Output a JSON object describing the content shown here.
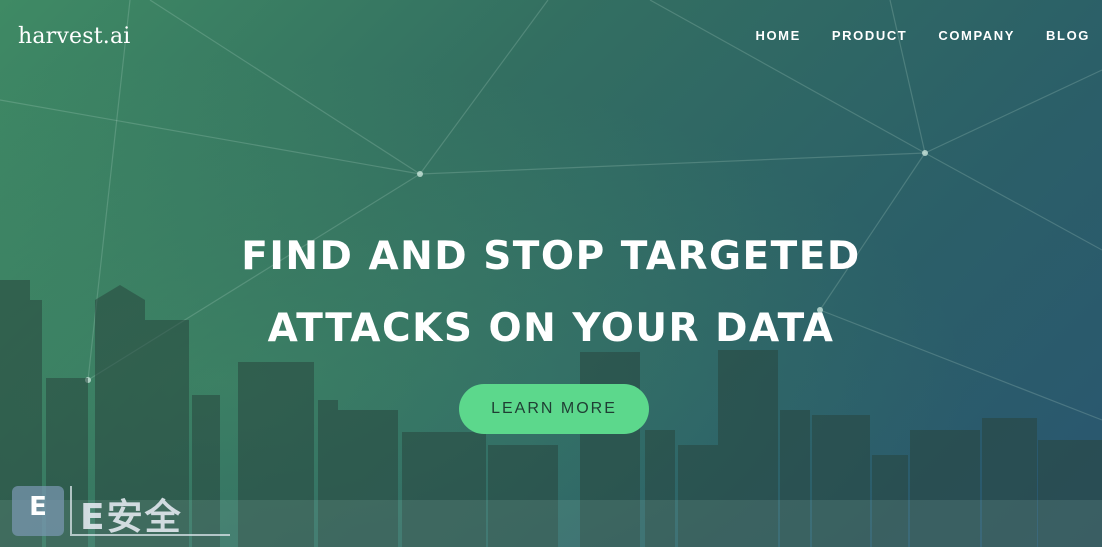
{
  "brand": {
    "logo_text": "harvest.ai"
  },
  "nav": {
    "items": [
      {
        "label": "HOME"
      },
      {
        "label": "PRODUCT"
      },
      {
        "label": "COMPANY"
      },
      {
        "label": "BLOG"
      }
    ]
  },
  "hero": {
    "headline_line1": "FIND AND STOP TARGETED",
    "headline_line2": "ATTACKS ON YOUR DATA",
    "cta_label": "LEARN MORE"
  },
  "watermark": {
    "badge_letter": "E",
    "text": "E安全"
  },
  "colors": {
    "gradient_start": "#3f8a64",
    "gradient_end": "#2a5670",
    "cta_background": "#5cd88c",
    "cta_text": "#1f3d33",
    "text": "#ffffff"
  },
  "icons": {
    "network": "network-lines-icon",
    "skyline": "city-skyline-icon",
    "watermark_badge": "e-badge-icon"
  }
}
